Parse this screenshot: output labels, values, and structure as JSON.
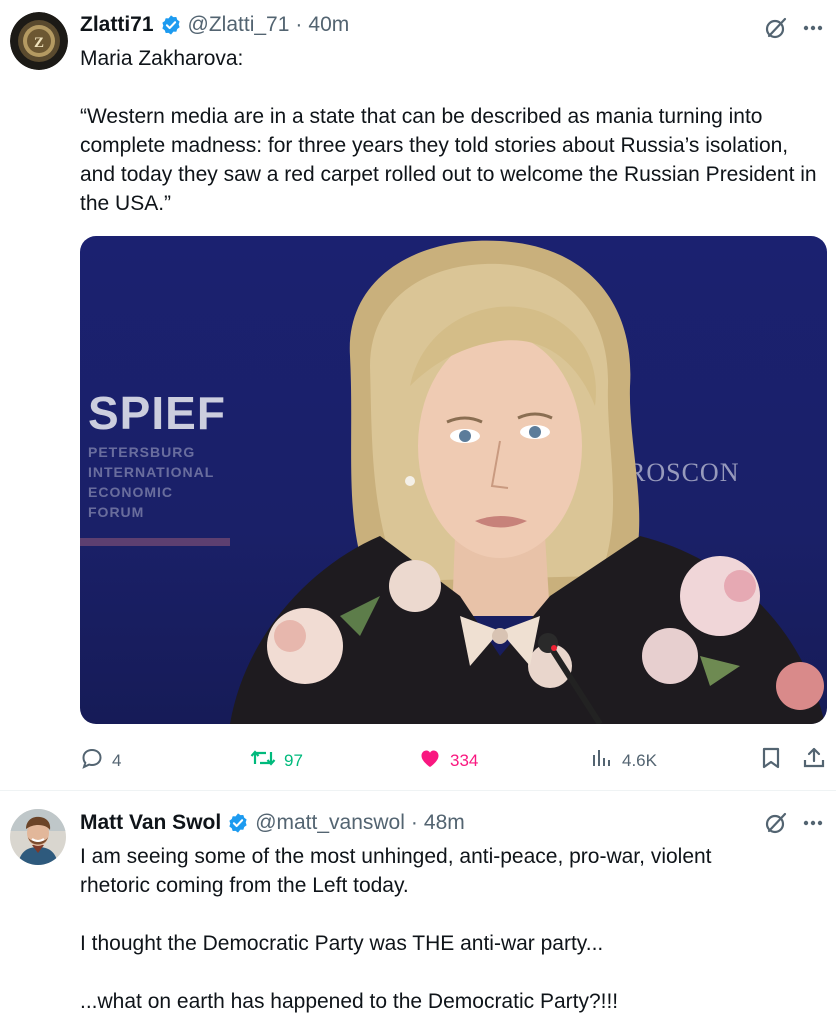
{
  "tweet1": {
    "display_name": "Zlatti71",
    "handle": "@Zlatti_71",
    "time": "40m",
    "text_lines": [
      "Maria Zakharova:",
      "",
      "“Western media are in a state that can be described as mania turning into complete madness: for three years they told stories about Russia’s isolation, and today they saw a red carpet rolled out to welcome the Russian President in the USA.”"
    ],
    "media": {
      "backdrop_text": "SPIEF",
      "backdrop_sub": [
        "PETERSBURG",
        "INTERNATIONAL",
        "ECONOMIC",
        "FORUM"
      ],
      "backdrop_right": "ROSCON"
    },
    "stats": {
      "replies": "4",
      "reposts": "97",
      "likes": "334",
      "views": "4.6K"
    }
  },
  "tweet2": {
    "display_name": "Matt Van Swol",
    "handle": "@matt_vanswol",
    "time": "48m",
    "text_lines": [
      "I am seeing some of the most unhinged, anti-peace, pro-war, violent rhetoric coming from the Left today.",
      "",
      "I thought the Democratic Party was THE anti-war party...",
      "",
      "...what on earth has happened to the Democratic Party?!!!"
    ]
  },
  "colors": {
    "verified": "#1d9bf0",
    "repost": "#00ba7c",
    "like": "#f91880",
    "muted": "#536471"
  },
  "icons": [
    "verified-badge-icon",
    "grok-icon",
    "more-icon",
    "reply-icon",
    "repost-icon",
    "like-icon",
    "views-icon",
    "bookmark-icon",
    "share-icon"
  ]
}
